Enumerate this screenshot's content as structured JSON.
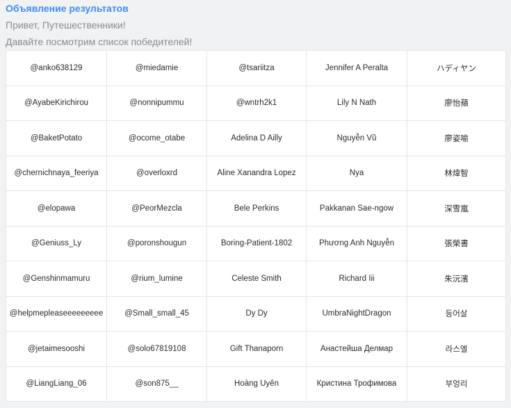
{
  "header": {
    "title": "Объявление результатов",
    "greeting": "Привет, Путешественники!",
    "subtitle": "Давайте посмотрим список победителей!"
  },
  "winners": [
    [
      "@anko638129",
      "@miedamie",
      "@tsariitza",
      "Jennifer A Peralta",
      "ハディヤン"
    ],
    [
      "@AyabeKirichirou",
      "@nonnipummu",
      "@wntrh2k1",
      "Lily N Nath",
      "廖怡蘋"
    ],
    [
      "@BaketPotato",
      "@ocome_otabe",
      "Adelina D Ailly",
      "Nguyễn Vũ",
      "廖姿喻"
    ],
    [
      "@chernichnaya_feeriya",
      "@overloxrd",
      "Aline Xanandra Lopez",
      "Nya",
      "林煒智"
    ],
    [
      "@elopawa",
      "@PeorMezcla",
      "Bele Perkins",
      "Pakkanan Sae-ngow",
      "深雪嵐"
    ],
    [
      "@Geniuss_Ly",
      "@poronshougun",
      "Boring-Patient-1802",
      "Phương Anh Nguyễn",
      "張榮書"
    ],
    [
      "@Genshinmamuru",
      "@rium_lumine",
      "Celeste Smith",
      "Richard Iii",
      "朱沅濱"
    ],
    [
      "@helpmepleaseeeeeeeee",
      "@Small_small_45",
      "Dy Dy",
      "UmbraNightDragon",
      "등어살"
    ],
    [
      "@jetaimesooshi",
      "@solo67819108",
      "Gift Thanaporn",
      "Анастейша Делмар",
      "라스엘"
    ],
    [
      "@LiangLiang_06",
      "@son875__",
      "Hoàng Uyên",
      "Кристина Трофимова",
      "부엉리"
    ]
  ]
}
